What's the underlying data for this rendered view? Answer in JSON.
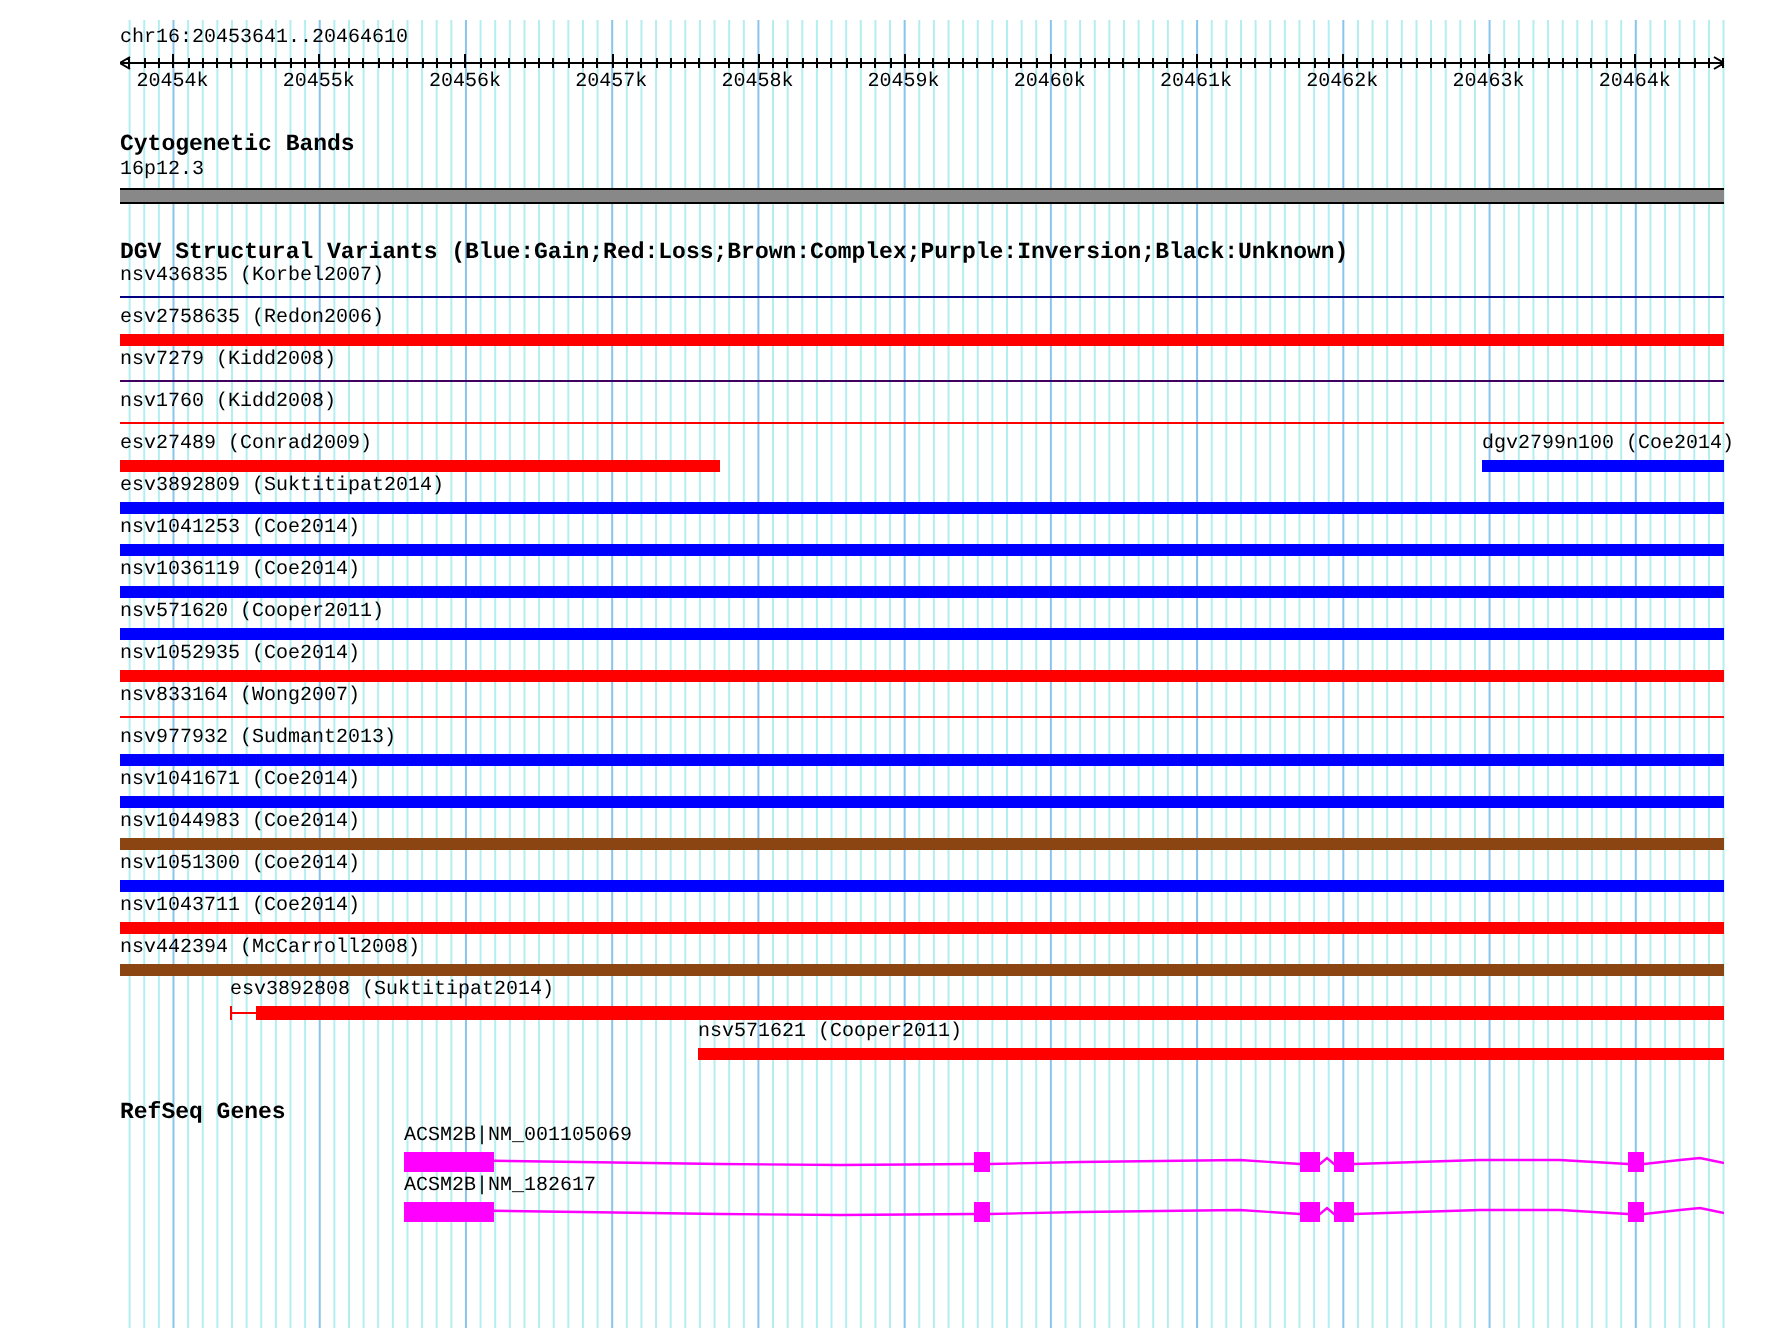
{
  "location": "chr16:20453641..20464610",
  "ruler": {
    "ticks": [
      "20454k",
      "20455k",
      "20456k",
      "20457k",
      "20458k",
      "20459k",
      "20460k",
      "20461k",
      "20462k",
      "20463k",
      "20464k"
    ]
  },
  "cytobands": {
    "title": "Cytogenetic Bands",
    "band": "16p12.3"
  },
  "variants": {
    "title": "DGV Structural Variants (Blue:Gain;Red:Loss;Brown:Complex;Purple:Inversion;Black:Unknown)",
    "rows": [
      [
        {
          "label": "nsv436835 (Korbel2007)",
          "kind": "line",
          "color": "#000080"
        }
      ],
      [
        {
          "label": "esv2758635 (Redon2006)",
          "kind": "bar",
          "color": "#ff0000"
        }
      ],
      [
        {
          "label": "nsv7279 (Kidd2008)",
          "kind": "line",
          "color": "#400060"
        }
      ],
      [
        {
          "label": "nsv1760 (Kidd2008)",
          "kind": "line",
          "color": "#ff0000"
        }
      ],
      [
        {
          "label": "esv27489 (Conrad2009)",
          "kind": "bar",
          "color": "#ff0000"
        },
        {
          "label": "dgv2799n100 (Coe2014)",
          "kind": "bar",
          "color": "#0000ff"
        }
      ],
      [
        {
          "label": "esv3892809 (Suktitipat2014)",
          "kind": "bar",
          "color": "#0000ff"
        }
      ],
      [
        {
          "label": "nsv1041253 (Coe2014)",
          "kind": "bar",
          "color": "#0000ff"
        }
      ],
      [
        {
          "label": "nsv1036119 (Coe2014)",
          "kind": "bar",
          "color": "#0000ff"
        }
      ],
      [
        {
          "label": "nsv571620 (Cooper2011)",
          "kind": "bar",
          "color": "#0000ff"
        }
      ],
      [
        {
          "label": "nsv1052935 (Coe2014)",
          "kind": "bar",
          "color": "#ff0000"
        }
      ],
      [
        {
          "label": "nsv833164 (Wong2007)",
          "kind": "line",
          "color": "#ff0000"
        }
      ],
      [
        {
          "label": "nsv977932 (Sudmant2013)",
          "kind": "bar",
          "color": "#0000ff"
        }
      ],
      [
        {
          "label": "nsv1041671 (Coe2014)",
          "kind": "bar",
          "color": "#0000ff"
        }
      ],
      [
        {
          "label": "nsv1044983 (Coe2014)",
          "kind": "bar",
          "color": "#8b4513"
        }
      ],
      [
        {
          "label": "nsv1051300 (Coe2014)",
          "kind": "bar",
          "color": "#0000ff"
        }
      ],
      [
        {
          "label": "nsv1043711 (Coe2014)",
          "kind": "bar",
          "color": "#ff0000"
        }
      ],
      [
        {
          "label": "nsv442394 (McCarroll2008)",
          "kind": "bar",
          "color": "#8b4513"
        }
      ],
      [
        {
          "label": "esv3892808 (Suktitipat2014)",
          "kind": "tailed-bar",
          "color": "#ff0000"
        }
      ],
      [
        {
          "label": "nsv571621 (Cooper2011)",
          "kind": "bar",
          "color": "#ff0000"
        }
      ]
    ]
  },
  "genes": {
    "title": "RefSeq Genes",
    "transcripts": [
      {
        "name": "ACSM2B|NM_001105069"
      },
      {
        "name": "ACSM2B|NM_182617"
      }
    ]
  }
}
